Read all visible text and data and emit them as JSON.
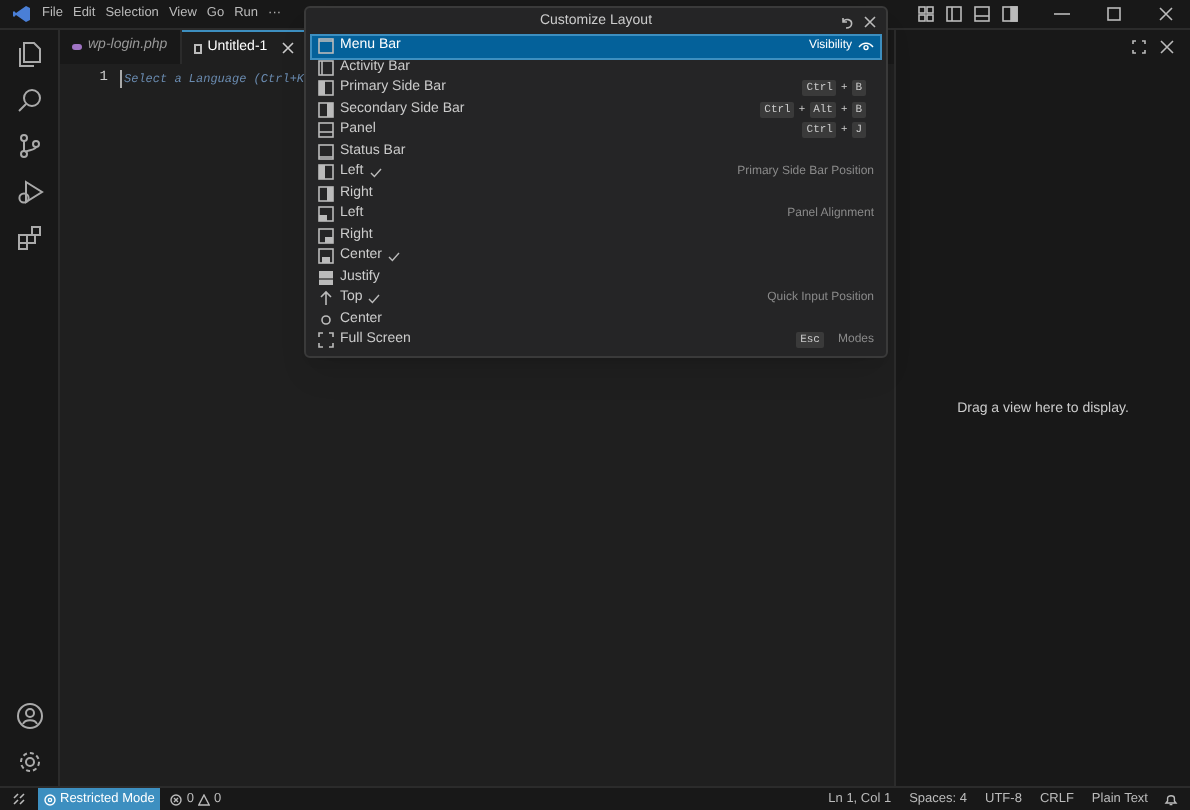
{
  "menu": [
    "File",
    "Edit",
    "Selection",
    "View",
    "Go",
    "Run",
    "···"
  ],
  "tabs": [
    {
      "label": "wp-login.php",
      "kind": "php",
      "selected": false,
      "italic": true
    },
    {
      "label": "Untitled-1",
      "kind": "text",
      "selected": true,
      "italic": false
    }
  ],
  "editor": {
    "line_number": "1",
    "hint": "Select a Language (Ctrl+K"
  },
  "secondary_side_bar": {
    "message": "Drag a view here to display."
  },
  "quick_pick": {
    "title": "Customize Layout",
    "items": [
      {
        "kind": "menubar",
        "label": "Menu Bar",
        "checked": false,
        "selected": true,
        "group": "Visibility"
      },
      {
        "kind": "activitybar",
        "label": "Activity Bar",
        "checked": false,
        "selected": false
      },
      {
        "kind": "sideleft",
        "label": "Primary Side Bar",
        "checked": false,
        "selected": false,
        "keys": [
          {
            "kind": "key",
            "text": "Ctrl"
          },
          {
            "kind": "plus",
            "text": "+"
          },
          {
            "kind": "key",
            "text": "B"
          }
        ]
      },
      {
        "kind": "sideright",
        "label": "Secondary Side Bar",
        "checked": false,
        "selected": false,
        "keys": [
          {
            "kind": "key",
            "text": "Ctrl"
          },
          {
            "kind": "plus",
            "text": "+"
          },
          {
            "kind": "key",
            "text": "Alt"
          },
          {
            "kind": "plus",
            "text": "+"
          },
          {
            "kind": "key",
            "text": "B"
          }
        ]
      },
      {
        "kind": "panel",
        "label": "Panel",
        "checked": false,
        "selected": false,
        "keys": [
          {
            "kind": "key",
            "text": "Ctrl"
          },
          {
            "kind": "plus",
            "text": "+"
          },
          {
            "kind": "key",
            "text": "J"
          }
        ]
      },
      {
        "kind": "statusbar",
        "label": "Status Bar",
        "checked": false,
        "selected": false
      },
      {
        "kind": "sideleft",
        "label": "Left",
        "checked": true,
        "selected": false,
        "group": "Primary Side Bar Position"
      },
      {
        "kind": "sideright",
        "label": "Right",
        "checked": false,
        "selected": false
      },
      {
        "kind": "panelleft",
        "label": "Left",
        "checked": false,
        "selected": false,
        "group": "Panel Alignment"
      },
      {
        "kind": "panelright",
        "label": "Right",
        "checked": false,
        "selected": false
      },
      {
        "kind": "panelcenter",
        "label": "Center",
        "checked": true,
        "selected": false
      },
      {
        "kind": "paneljustify",
        "label": "Justify",
        "checked": false,
        "selected": false
      },
      {
        "kind": "arrowup",
        "label": "Top",
        "checked": true,
        "selected": false,
        "group": "Quick Input Position"
      },
      {
        "kind": "dot",
        "label": "Center",
        "checked": false,
        "selected": false
      },
      {
        "kind": "fullscreen",
        "label": "Full Screen",
        "checked": false,
        "selected": false,
        "keys": [
          {
            "kind": "key",
            "text": "Esc"
          }
        ],
        "group": "Modes"
      }
    ]
  },
  "status_bar": {
    "mode": "Restricted Mode",
    "errors": "0",
    "warnings": "0",
    "items": [
      "Ln 1, Col 1",
      "Spaces: 4",
      "UTF-8",
      "CRLF",
      "Plain Text"
    ]
  }
}
